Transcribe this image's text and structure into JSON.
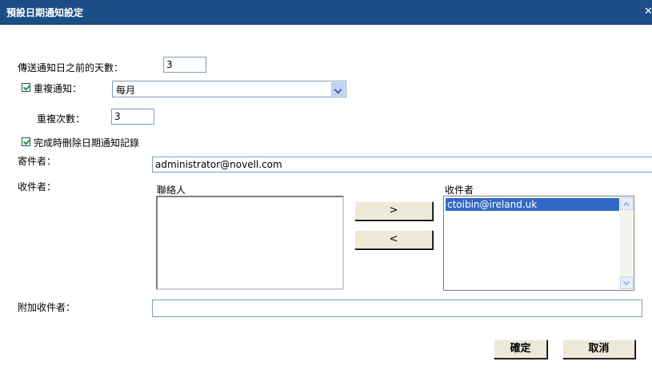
{
  "dialog": {
    "title": "預設日期通知設定",
    "close_glyph": "✕"
  },
  "form": {
    "days_before_label": "傳送通知日之前的天數：",
    "days_before_value": "3",
    "repeat_label": "重複通知：",
    "repeat_checked": true,
    "repeat_interval": "每月",
    "repeat_count_label": "重複次數：",
    "repeat_count_value": "3",
    "delete_on_complete_label": "完成時刪除日期通知記錄",
    "delete_on_complete_checked": true,
    "sender_label": "寄件者：",
    "sender_value": "administrator@novell.com",
    "recipients_label": "收件者：",
    "contacts_header": "聯絡人",
    "recipients_header": "收件者",
    "contacts": [],
    "recipients": [
      "ctoibin@ireland.uk"
    ],
    "add_button": ">",
    "remove_button": "<",
    "extra_recipients_label": "附加收件者：",
    "extra_recipients_value": ""
  },
  "footer": {
    "ok_label": "確定",
    "cancel_label": "取消"
  }
}
